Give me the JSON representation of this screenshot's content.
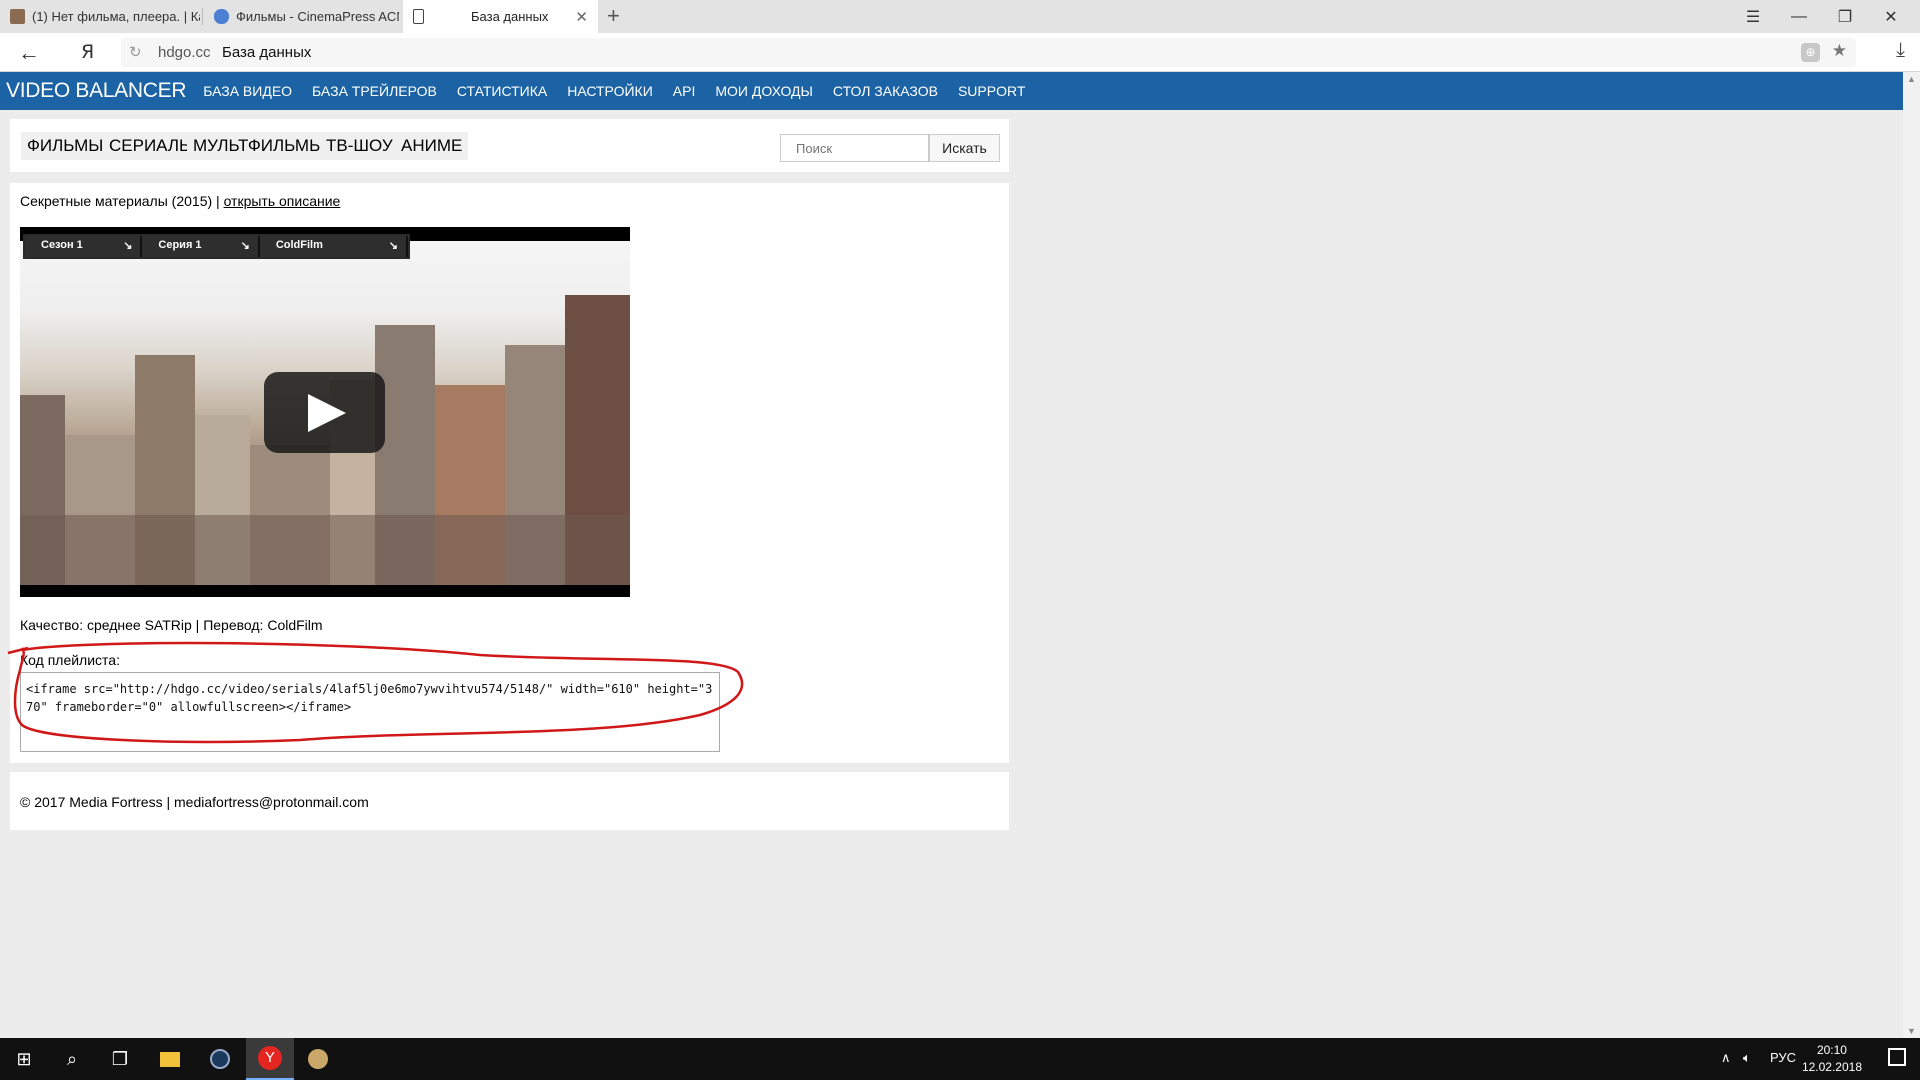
{
  "browser": {
    "tabs": [
      {
        "title": "(1) Нет фильма, плеера. | Ка"
      },
      {
        "title": "Фильмы - CinemaPress ACM"
      },
      {
        "title": "База данных"
      }
    ],
    "new_tab": "+",
    "window_controls": {
      "menu": "☰",
      "minimize": "—",
      "restore": "❐",
      "close": "✕"
    },
    "address": {
      "domain": "hdgo.cc",
      "page_title": "База данных"
    }
  },
  "site_nav": {
    "brand": "VIDEO BALANCER",
    "links": [
      "БАЗА ВИДЕО",
      "БАЗА ТРЕЙЛЕРОВ",
      "СТАТИСТИКА",
      "НАСТРОЙКИ",
      "API",
      "МОИ ДОХОДЫ",
      "СТОЛ ЗАКАЗОВ",
      "SUPPORT"
    ]
  },
  "categories": [
    "ФИЛЬМЫ",
    "СЕРИАЛЫ",
    "МУЛЬТФИЛЬМЫ",
    "ТВ-ШОУ",
    "АНИМЕ"
  ],
  "search": {
    "placeholder": "Поиск",
    "button": "Искать"
  },
  "movie": {
    "title": "Секретные материалы (2015)",
    "separator": " | ",
    "desc_link": "открыть описание"
  },
  "player": {
    "selectors": [
      {
        "label": "Сезон 1"
      },
      {
        "label": "Серия 1"
      },
      {
        "label": "ColdFilm"
      }
    ]
  },
  "info": {
    "quality": "Качество: среднее SATRip | Перевод: ColdFilm",
    "code_label": "Код плейлиста:",
    "code": "<iframe src=\"http://hdgo.cc/video/serials/4laf5lj0e6mo7ywvihtvu574/5148/\" width=\"610\" height=\"370\" frameborder=\"0\" allowfullscreen></iframe>"
  },
  "footer": {
    "text": "© 2017 Media Fortress | mediafortress@protonmail.com"
  },
  "taskbar": {
    "lang": "РУС",
    "time": "20:10",
    "date": "12.02.2018"
  },
  "colors": {
    "nav_bg": "#1b63a4",
    "annotation": "#d01818"
  }
}
